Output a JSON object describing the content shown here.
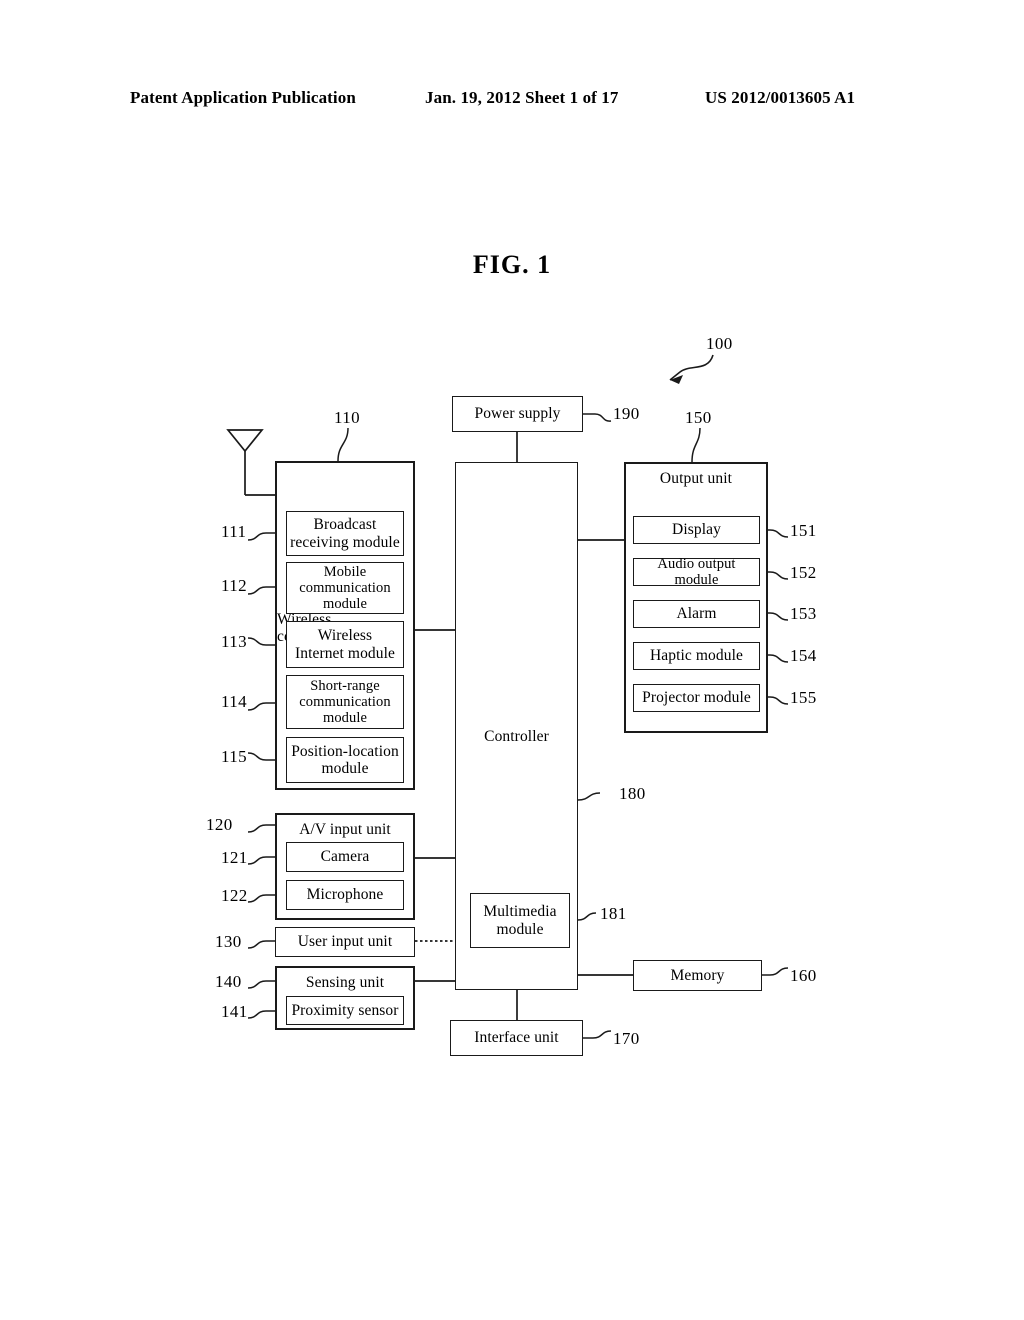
{
  "header": {
    "publication": "Patent Application Publication",
    "date_sheet": "Jan. 19, 2012  Sheet 1 of 17",
    "pub_number": "US 2012/0013605 A1"
  },
  "figure": {
    "title": "FIG. 1",
    "system_ref": "100"
  },
  "blocks": {
    "power_supply": {
      "label": "Power supply",
      "ref": "190"
    },
    "controller": {
      "label": "Controller",
      "ref": "180"
    },
    "multimedia_module": {
      "label": "Multimedia\nmodule",
      "line1": "Multimedia",
      "line2": "module",
      "ref": "181"
    },
    "memory": {
      "label": "Memory",
      "ref": "160"
    },
    "interface_unit": {
      "label": "Interface unit",
      "ref": "170"
    },
    "wireless_communication_unit": {
      "line1": "Wireless",
      "line2": "communication unit",
      "ref": "110",
      "modules": [
        {
          "ref": "111",
          "line1": "Broadcast",
          "line2": "receiving module",
          "line3": ""
        },
        {
          "ref": "112",
          "line1": "Mobile",
          "line2": "communication",
          "line3": "module"
        },
        {
          "ref": "113",
          "line1": "Wireless",
          "line2": "Internet module",
          "line3": ""
        },
        {
          "ref": "114",
          "line1": "Short-range",
          "line2": "communication",
          "line3": "module"
        },
        {
          "ref": "115",
          "line1": "Position-location",
          "line2": "module",
          "line3": ""
        }
      ]
    },
    "av_input_unit": {
      "label": "A/V input unit",
      "ref": "120",
      "modules": [
        {
          "ref": "121",
          "label": "Camera"
        },
        {
          "ref": "122",
          "label": "Microphone"
        }
      ]
    },
    "user_input_unit": {
      "label": "User input unit",
      "ref": "130"
    },
    "sensing_unit": {
      "label": "Sensing unit",
      "ref": "140",
      "modules": [
        {
          "ref": "141",
          "label": "Proximity sensor"
        }
      ]
    },
    "output_unit": {
      "label": "Output unit",
      "ref": "150",
      "modules": [
        {
          "ref": "151",
          "label": "Display"
        },
        {
          "ref": "152",
          "label": "Audio output module"
        },
        {
          "ref": "153",
          "label": "Alarm"
        },
        {
          "ref": "154",
          "label": "Haptic module"
        },
        {
          "ref": "155",
          "label": "Projector module"
        }
      ]
    },
    "antenna": {
      "name": "antenna-symbol"
    }
  },
  "colors": {
    "ink": "#1a1a1a",
    "paper": "#ffffff"
  }
}
